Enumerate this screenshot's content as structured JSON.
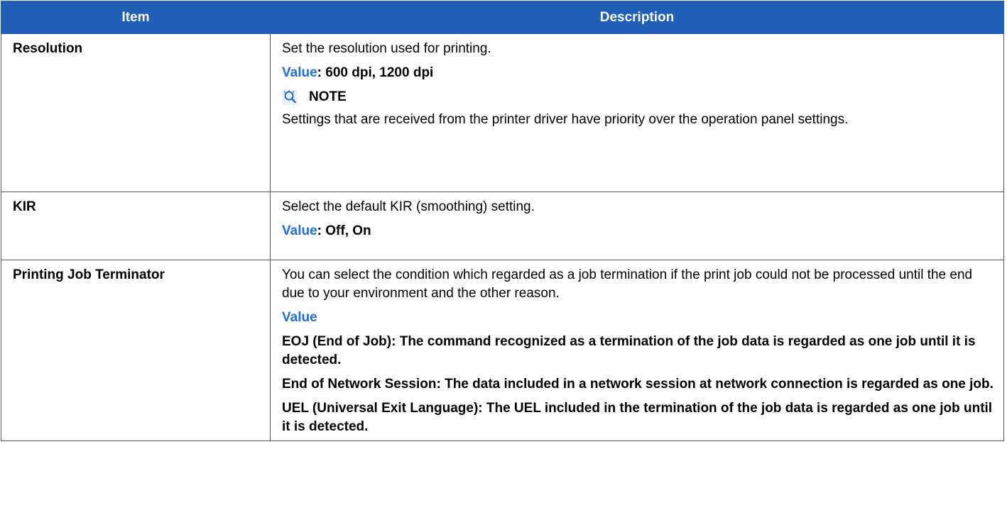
{
  "headers": {
    "item": "Item",
    "description": "Description"
  },
  "rows": [
    {
      "item": "Resolution",
      "intro": "Set the resolution used for printing.",
      "value_label": "Value",
      "value_text": ": 600 dpi, 1200 dpi",
      "note_title": "NOTE",
      "note_text": "Settings that are received from the printer driver have priority over the operation panel settings."
    },
    {
      "item": "KIR",
      "intro": "Select the default KIR (smoothing) setting.",
      "value_label": "Value",
      "value_text": ": Off, On"
    },
    {
      "item": "Printing Job Terminator",
      "intro": "You can select the condition which regarded as a job termination if the print job could not be processed until the end due to your environment and the other reason.",
      "value_label": "Value",
      "options": [
        "EOJ (End of Job): The command recognized as a termination of the job data is regarded as one job until it is detected.",
        "End of Network Session: The data included in a network session at network connection is regarded as one job.",
        "UEL (Universal Exit Language): The UEL included in the termination of the job data is regarded as one job until it is detected."
      ]
    }
  ],
  "colors": {
    "header_bg": "#1f5fb8",
    "value_label": "#1f6fe0"
  },
  "icons": {
    "note": "note-icon"
  }
}
